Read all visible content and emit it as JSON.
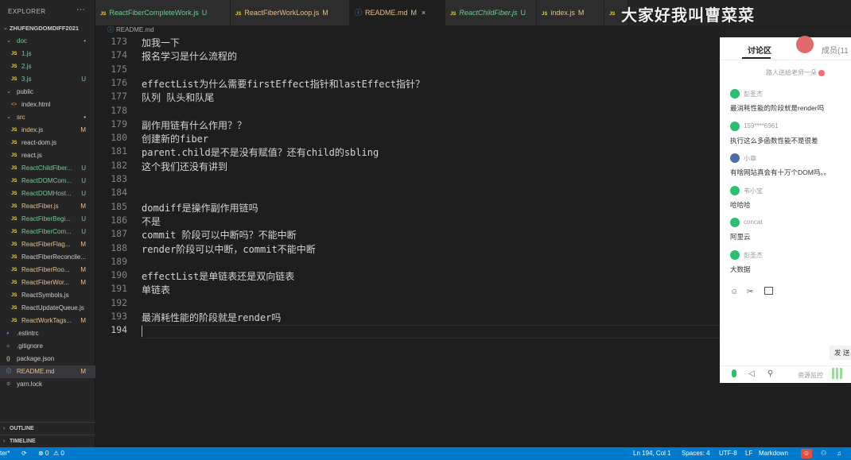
{
  "explorer": {
    "title": "EXPLORER",
    "more": "···",
    "project": "ZHUFENGDOMDIFF2021",
    "tree": [
      {
        "label": "doc",
        "kind": "folder",
        "status": "•",
        "status_color": "#73c991",
        "color": "#73c991",
        "indent": 1
      },
      {
        "label": "1.js",
        "kind": "js",
        "status": "",
        "color": "#73c991",
        "indent": 2
      },
      {
        "label": "2.js",
        "kind": "js",
        "status": "",
        "color": "#73c991",
        "indent": 2
      },
      {
        "label": "3.js",
        "kind": "js",
        "status": "U",
        "status_color": "#73c991",
        "color": "#73c991",
        "indent": 2
      },
      {
        "label": "public",
        "kind": "folder",
        "status": "",
        "color": "#cccccc",
        "indent": 1
      },
      {
        "label": "index.html",
        "kind": "html",
        "status": "",
        "color": "#cccccc",
        "indent": 2
      },
      {
        "label": "src",
        "kind": "folder",
        "status": "•",
        "status_color": "#e2c08d",
        "color": "#e2c08d",
        "indent": 1
      },
      {
        "label": "index.js",
        "kind": "js",
        "status": "M",
        "status_color": "#e2c08d",
        "color": "#e2c08d",
        "indent": 2
      },
      {
        "label": "react-dom.js",
        "kind": "js",
        "status": "",
        "color": "#cccccc",
        "indent": 2
      },
      {
        "label": "react.js",
        "kind": "js",
        "status": "",
        "color": "#cccccc",
        "indent": 2
      },
      {
        "label": "ReactChildFiber...",
        "kind": "js",
        "status": "U",
        "status_color": "#73c991",
        "color": "#73c991",
        "indent": 2
      },
      {
        "label": "ReactDOMCom...",
        "kind": "js",
        "status": "U",
        "status_color": "#73c991",
        "color": "#73c991",
        "indent": 2
      },
      {
        "label": "ReactDOMHost...",
        "kind": "js",
        "status": "U",
        "status_color": "#73c991",
        "color": "#73c991",
        "indent": 2
      },
      {
        "label": "ReactFiber.js",
        "kind": "js",
        "status": "M",
        "status_color": "#e2c08d",
        "color": "#e2c08d",
        "indent": 2
      },
      {
        "label": "ReactFiberBegi...",
        "kind": "js",
        "status": "U",
        "status_color": "#73c991",
        "color": "#73c991",
        "indent": 2
      },
      {
        "label": "ReactFiberCom...",
        "kind": "js",
        "status": "U",
        "status_color": "#73c991",
        "color": "#73c991",
        "indent": 2
      },
      {
        "label": "ReactFiberFlag...",
        "kind": "js",
        "status": "M",
        "status_color": "#e2c08d",
        "color": "#e2c08d",
        "indent": 2
      },
      {
        "label": "ReactFiberReconcile...",
        "kind": "js",
        "status": "",
        "color": "#cccccc",
        "indent": 2
      },
      {
        "label": "ReactFiberRoo...",
        "kind": "js",
        "status": "M",
        "status_color": "#e2c08d",
        "color": "#e2c08d",
        "indent": 2
      },
      {
        "label": "ReactFiberWor...",
        "kind": "js",
        "status": "M",
        "status_color": "#e2c08d",
        "color": "#e2c08d",
        "indent": 2
      },
      {
        "label": "ReactSymbols.js",
        "kind": "js",
        "status": "",
        "color": "#cccccc",
        "indent": 2
      },
      {
        "label": "ReactUpdateQueue.js",
        "kind": "js",
        "status": "",
        "color": "#cccccc",
        "indent": 2
      },
      {
        "label": "ReactWorkTags...",
        "kind": "js",
        "status": "M",
        "status_color": "#e2c08d",
        "color": "#e2c08d",
        "indent": 2
      },
      {
        "label": ".eslintrc",
        "kind": "eslint",
        "status": "",
        "color": "#cccccc",
        "indent": 1
      },
      {
        "label": ".gitignore",
        "kind": "git",
        "status": "",
        "color": "#cccccc",
        "indent": 1
      },
      {
        "label": "package.json",
        "kind": "json",
        "status": "",
        "color": "#cccccc",
        "indent": 1
      },
      {
        "label": "README.md",
        "kind": "md",
        "status": "M",
        "status_color": "#e2c08d",
        "color": "#e2c08d",
        "indent": 1,
        "active": true
      },
      {
        "label": "yarn.lock",
        "kind": "lock",
        "status": "",
        "color": "#cccccc",
        "indent": 1
      }
    ],
    "outline": "OUTLINE",
    "timeline": "TIMELINE"
  },
  "tabs": [
    {
      "label": "ReactFiberCompleteWork.js",
      "status": "U",
      "icon": "JS",
      "color": "#73c991",
      "italic": false
    },
    {
      "label": "ReactFiberWorkLoop.js",
      "status": "M",
      "icon": "JS",
      "color": "#e2c08d",
      "italic": false
    },
    {
      "label": "README.md",
      "status": "M",
      "icon": "ⓘ",
      "color": "#e2c08d",
      "italic": false,
      "active": true,
      "close": "×"
    },
    {
      "label": "ReactChildFiber.js",
      "status": "U",
      "icon": "JS",
      "color": "#73c991",
      "italic": true
    },
    {
      "label": "index.js",
      "status": "M",
      "icon": "JS",
      "color": "#e2c08d",
      "italic": false
    },
    {
      "label": "",
      "status": "",
      "icon": "JS",
      "color": "#cccccc",
      "italic": false
    }
  ],
  "breadcrumb": {
    "icon": "ⓘ",
    "label": "README.md"
  },
  "editor": {
    "lines": [
      {
        "n": "173",
        "text": "加我一下"
      },
      {
        "n": "174",
        "text": "报名学习是什么流程的"
      },
      {
        "n": "175",
        "text": ""
      },
      {
        "n": "176",
        "text": "effectList为什么需要firstEffect指针和lastEffect指针？"
      },
      {
        "n": "177",
        "text": "队列 队头和队尾"
      },
      {
        "n": "178",
        "text": ""
      },
      {
        "n": "179",
        "text": "副作用链有什么作用？？"
      },
      {
        "n": "180",
        "text": "创建新的fiber"
      },
      {
        "n": "181",
        "text": "parent.child是不是没有赋值？还有child的sbling"
      },
      {
        "n": "182",
        "text": "这个我们还没有讲到"
      },
      {
        "n": "183",
        "text": ""
      },
      {
        "n": "184",
        "text": ""
      },
      {
        "n": "185",
        "text": "domdiff是操作副作用链吗"
      },
      {
        "n": "186",
        "text": "不是"
      },
      {
        "n": "187",
        "text": "commit 阶段可以中断吗？不能中断"
      },
      {
        "n": "188",
        "text": "render阶段可以中断，commit不能中断"
      },
      {
        "n": "189",
        "text": ""
      },
      {
        "n": "190",
        "text": "effectList是单链表还是双向链表"
      },
      {
        "n": "191",
        "text": "单链表"
      },
      {
        "n": "192",
        "text": ""
      },
      {
        "n": "193",
        "text": "最消耗性能的阶段就是render吗"
      },
      {
        "n": "194",
        "text": "",
        "current": true
      }
    ]
  },
  "overlay": {
    "text": "大家好我叫曹菜菜"
  },
  "chat": {
    "tab_discussion": "讨论区",
    "tab_members": "成员(11",
    "notice": "路人送给老师一朵",
    "messages": [
      {
        "name": "彭圣杰",
        "text": "最消耗性能的阶段就是render吗",
        "avatar_color": "#2ac06e"
      },
      {
        "name": "159****6961",
        "text": "执行这么多函数性能不是很差",
        "avatar_color": "#2ac06e"
      },
      {
        "name": "小章",
        "text": "有啥网站真会有十万个DOM吗。。",
        "avatar_color": "#4a6fa5"
      },
      {
        "name": "韦小宝",
        "text": "哈哈哈",
        "avatar_color": "#2ac06e"
      },
      {
        "name": "concat",
        "text": "阿里云",
        "avatar_color": "#2ac06e"
      },
      {
        "name": "彭圣杰",
        "text": "大数据",
        "avatar_color": "#2ac06e"
      }
    ],
    "send": "发 送",
    "monitor": "资源监控"
  },
  "status": {
    "branch": "ter*",
    "errors": "⊗ 0",
    "warnings": "⚠ 0",
    "position": "Ln 194, Col 1",
    "spaces": "Spaces: 4",
    "encoding": "UTF-8",
    "eol": "LF",
    "language": "Markdown"
  }
}
